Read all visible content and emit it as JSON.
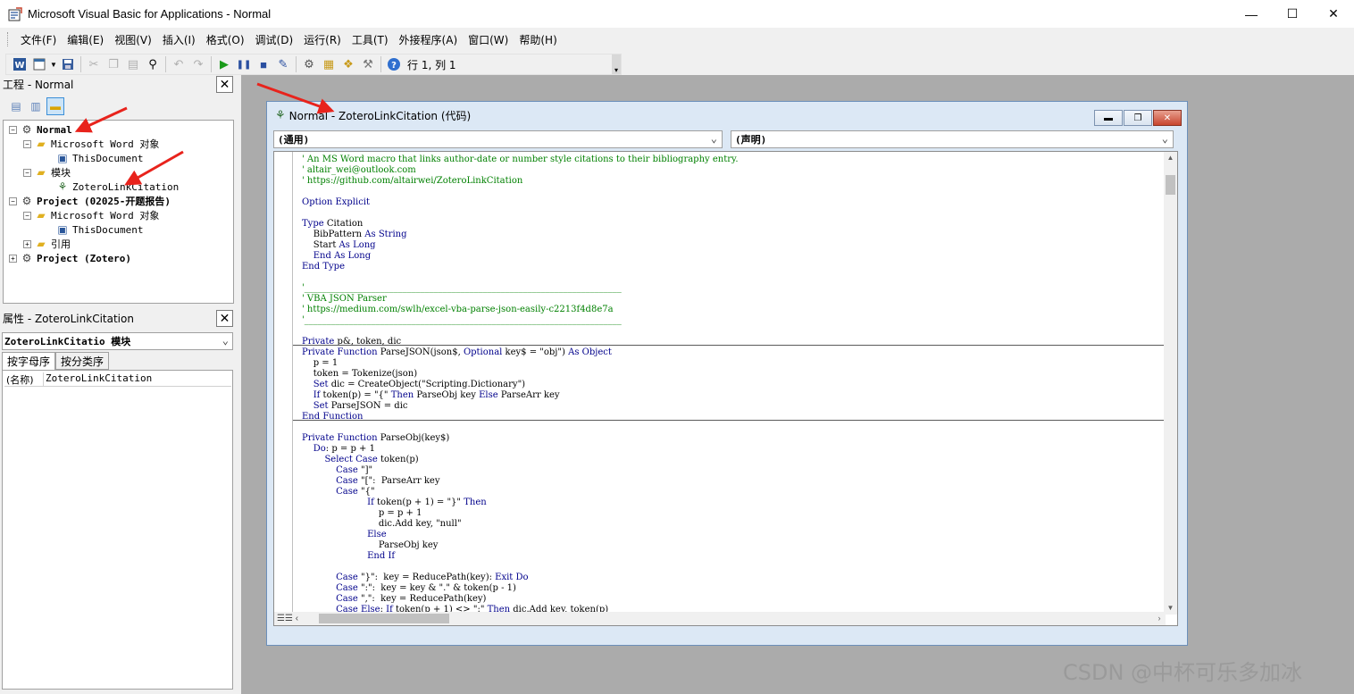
{
  "window": {
    "title": "Microsoft Visual Basic for Applications - Normal",
    "controls": {
      "minimize": "—",
      "maximize": "☐",
      "close": "✕"
    }
  },
  "menu": [
    "文件(F)",
    "编辑(E)",
    "视图(V)",
    "插入(I)",
    "格式(O)",
    "调试(D)",
    "运行(R)",
    "工具(T)",
    "外接程序(A)",
    "窗口(W)",
    "帮助(H)"
  ],
  "toolbar": {
    "position": "行 1, 列 1",
    "icons": [
      "word-view-icon",
      "insert-module-icon",
      "save-icon",
      "cut-icon",
      "copy-icon",
      "paste-icon",
      "find-icon",
      "undo-icon",
      "redo-icon",
      "run-icon",
      "break-icon",
      "reset-icon",
      "design-mode-icon",
      "project-explorer-icon",
      "properties-icon",
      "object-browser-icon",
      "toolbox-icon",
      "help-icon"
    ]
  },
  "project_panel": {
    "title": "工程 - Normal",
    "tree": [
      {
        "label": "Normal",
        "level": 0,
        "kind": "project",
        "expander": "−",
        "bold": true
      },
      {
        "label": "Microsoft Word 对象",
        "level": 1,
        "kind": "folder",
        "expander": "−"
      },
      {
        "label": "ThisDocument",
        "level": 2,
        "kind": "doc",
        "expander": ""
      },
      {
        "label": "模块",
        "level": 1,
        "kind": "folder",
        "expander": "−"
      },
      {
        "label": "ZoteroLinkCitation",
        "level": 2,
        "kind": "module",
        "expander": ""
      },
      {
        "label": "Project (02025-开题报告)",
        "level": 0,
        "kind": "project",
        "expander": "−",
        "bold": true
      },
      {
        "label": "Microsoft Word 对象",
        "level": 1,
        "kind": "folder",
        "expander": "−"
      },
      {
        "label": "ThisDocument",
        "level": 2,
        "kind": "doc",
        "expander": ""
      },
      {
        "label": "引用",
        "level": 1,
        "kind": "folder",
        "expander": "+"
      },
      {
        "label": "Project (Zotero)",
        "level": 0,
        "kind": "project",
        "expander": "+",
        "bold": true
      }
    ]
  },
  "properties_panel": {
    "title": "属性 - ZoteroLinkCitation",
    "object_select": "ZoteroLinkCitatio 模块",
    "tabs": [
      "按字母序",
      "按分类序"
    ],
    "rows": [
      {
        "key": "(名称)",
        "value": "ZoteroLinkCitation"
      }
    ]
  },
  "code_window": {
    "title": "Normal - ZoteroLinkCitation (代码)",
    "object_combo": "(通用)",
    "proc_combo": "(声明)",
    "lines": [
      "' An MS Word macro that links author-date or number style citations to their bibliography entry.",
      "' altair_wei@outlook.com",
      "' https://github.com/altairwei/ZoteroLinkCitation",
      "",
      "Option Explicit",
      "",
      "Type Citation",
      "    BibPattern As String",
      "    Start As Long",
      "    End As Long",
      "End Type",
      "",
      "'_______________________________________________________________________",
      "' VBA JSON Parser",
      "' https://medium.com/swlh/excel-vba-parse-json-easily-c2213f4d8e7a",
      "'_______________________________________________________________________",
      "",
      "Private p&, token, dic",
      "Private Function ParseJSON(json$, Optional key$ = \"obj\") As Object",
      "    p = 1",
      "    token = Tokenize(json)",
      "    Set dic = CreateObject(\"Scripting.Dictionary\")",
      "    If token(p) = \"{\" Then ParseObj key Else ParseArr key",
      "    Set ParseJSON = dic",
      "End Function",
      "",
      "Private Function ParseObj(key$)",
      "    Do: p = p + 1",
      "        Select Case token(p)",
      "            Case \"]\"",
      "            Case \"[\":  ParseArr key",
      "            Case \"{\"",
      "                       If token(p + 1) = \"}\" Then",
      "                           p = p + 1",
      "                           dic.Add key, \"null\"",
      "                       Else",
      "                           ParseObj key",
      "                       End If",
      "",
      "            Case \"}\":  key = ReducePath(key): Exit Do",
      "            Case \":\":  key = key & \".\" & token(p - 1)",
      "            Case \",\":  key = ReducePath(key)",
      "            Case Else: If token(p + 1) <> \":\" Then dic.Add key, token(p)"
    ]
  },
  "watermark": "CSDN @中杯可乐多加冰",
  "colors": {
    "comment": "#008000",
    "keyword": "#00008b",
    "mdi_bg": "#ababab",
    "arrow": "#e8231c"
  }
}
